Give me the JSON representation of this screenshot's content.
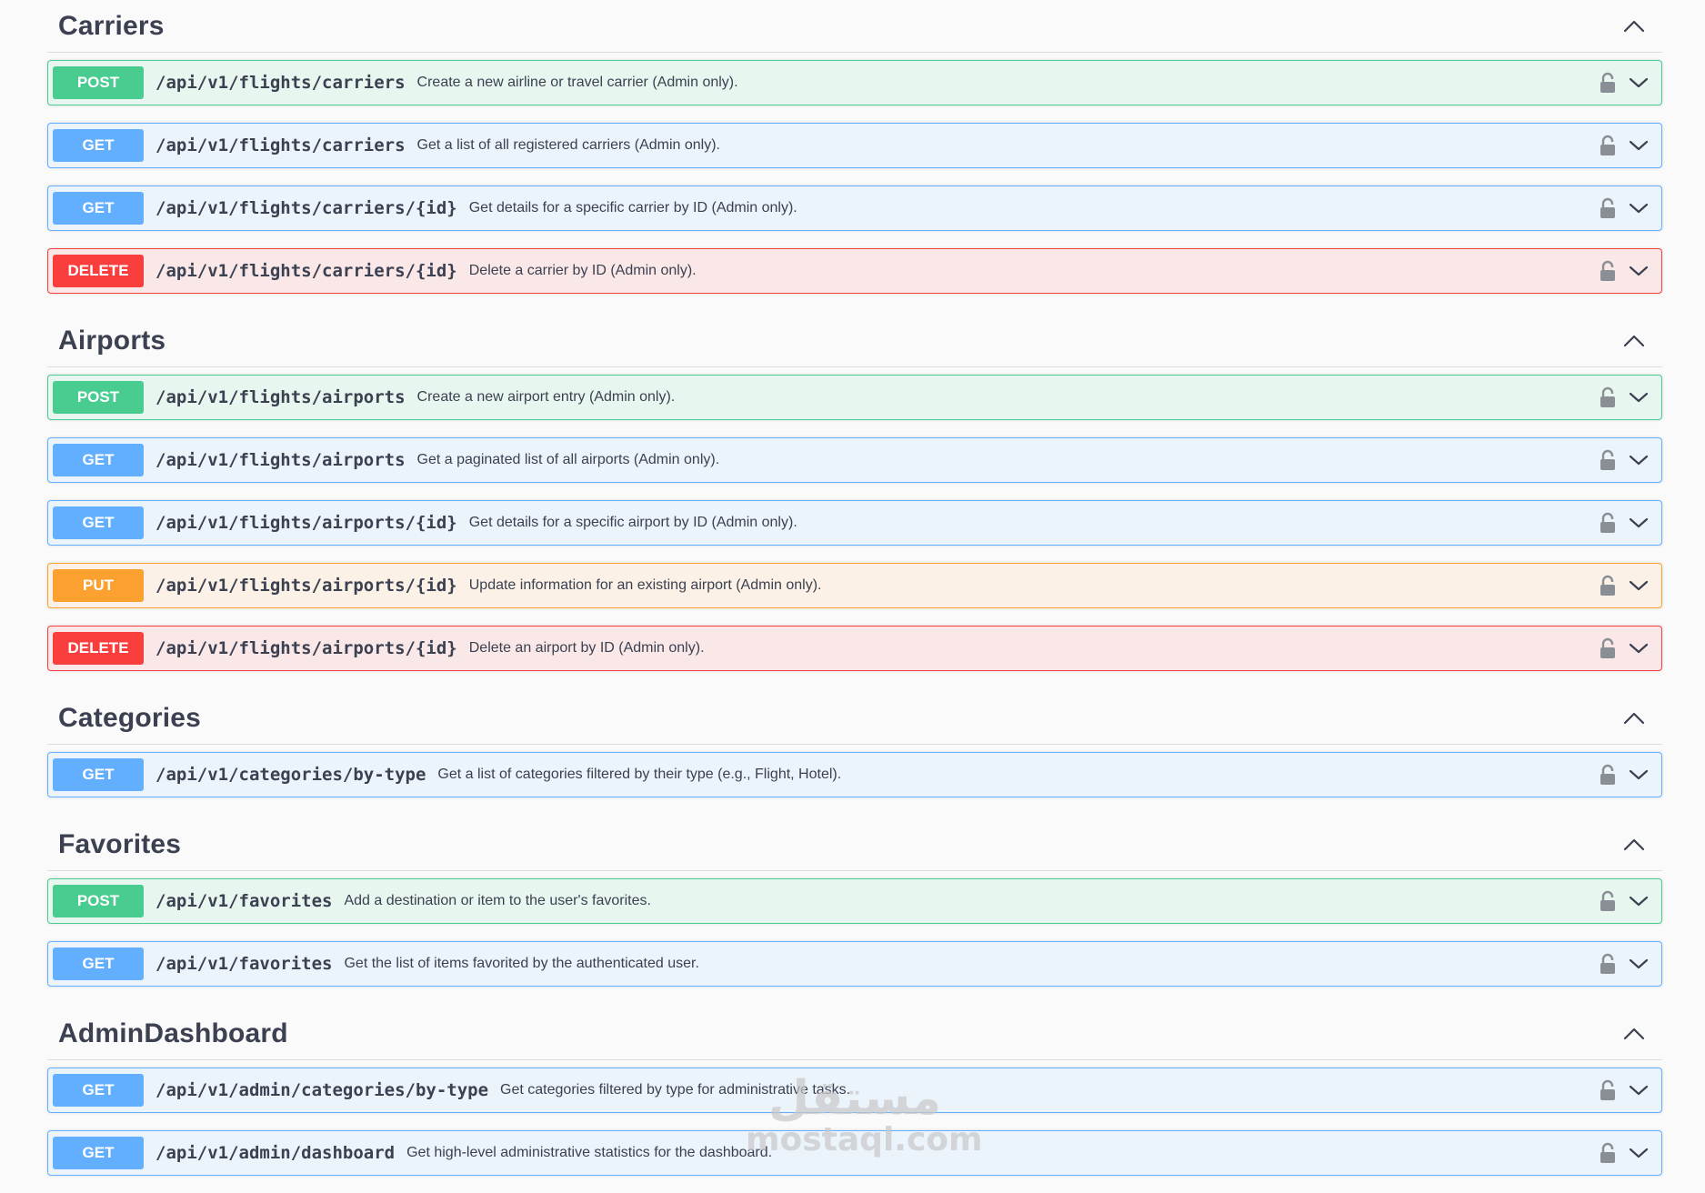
{
  "colors": {
    "post": "#49cc90",
    "get": "#61affe",
    "put": "#fca130",
    "delete": "#f93e3e",
    "text": "#3b4151"
  },
  "sections": [
    {
      "title": "Carriers",
      "operations": [
        {
          "method": "POST",
          "path": "/api/v1/flights/carriers",
          "summary": "Create a new airline or travel carrier (Admin only)."
        },
        {
          "method": "GET",
          "path": "/api/v1/flights/carriers",
          "summary": "Get a list of all registered carriers (Admin only)."
        },
        {
          "method": "GET",
          "path": "/api/v1/flights/carriers/{id}",
          "summary": "Get details for a specific carrier by ID (Admin only)."
        },
        {
          "method": "DELETE",
          "path": "/api/v1/flights/carriers/{id}",
          "summary": "Delete a carrier by ID (Admin only)."
        }
      ]
    },
    {
      "title": "Airports",
      "operations": [
        {
          "method": "POST",
          "path": "/api/v1/flights/airports",
          "summary": "Create a new airport entry (Admin only)."
        },
        {
          "method": "GET",
          "path": "/api/v1/flights/airports",
          "summary": "Get a paginated list of all airports (Admin only)."
        },
        {
          "method": "GET",
          "path": "/api/v1/flights/airports/{id}",
          "summary": "Get details for a specific airport by ID (Admin only)."
        },
        {
          "method": "PUT",
          "path": "/api/v1/flights/airports/{id}",
          "summary": "Update information for an existing airport (Admin only)."
        },
        {
          "method": "DELETE",
          "path": "/api/v1/flights/airports/{id}",
          "summary": "Delete an airport by ID (Admin only)."
        }
      ]
    },
    {
      "title": "Categories",
      "operations": [
        {
          "method": "GET",
          "path": "/api/v1/categories/by-type",
          "summary": "Get a list of categories filtered by their type (e.g., Flight, Hotel)."
        }
      ]
    },
    {
      "title": "Favorites",
      "operations": [
        {
          "method": "POST",
          "path": "/api/v1/favorites",
          "summary": "Add a destination or item to the user's favorites."
        },
        {
          "method": "GET",
          "path": "/api/v1/favorites",
          "summary": "Get the list of items favorited by the authenticated user."
        }
      ]
    },
    {
      "title": "AdminDashboard",
      "operations": [
        {
          "method": "GET",
          "path": "/api/v1/admin/categories/by-type",
          "summary": "Get categories filtered by type for administrative tasks."
        },
        {
          "method": "GET",
          "path": "/api/v1/admin/dashboard",
          "summary": "Get high-level administrative statistics for the dashboard."
        }
      ]
    }
  ],
  "watermark": {
    "arabic": "مستقل",
    "latin": "mostaql.com"
  }
}
